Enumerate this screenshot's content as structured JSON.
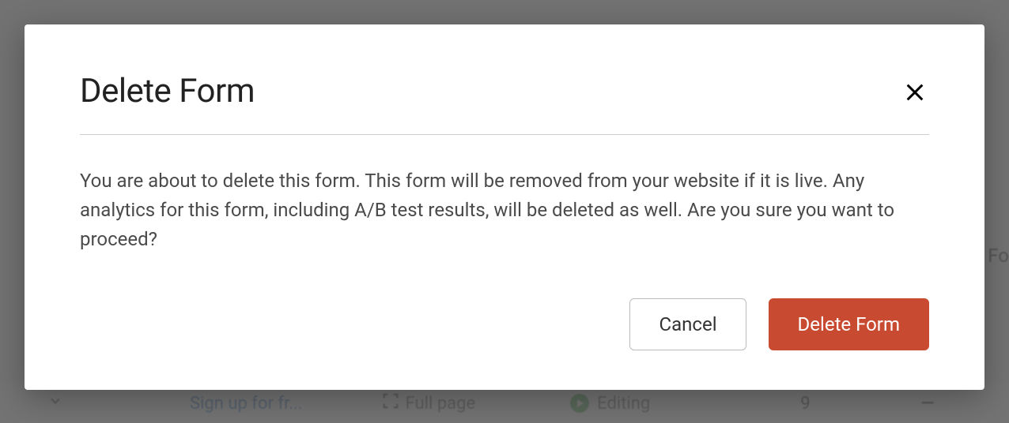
{
  "modal": {
    "title": "Delete Form",
    "body": "You are about to delete this form. This form will be removed from your website if it is live. Any analytics for this form, including A/B test results, will be deleted as well. Are you sure you want to proceed?",
    "cancel_label": "Cancel",
    "confirm_label": "Delete Form"
  },
  "background": {
    "row": {
      "link_text": "Sign up for fr...",
      "display_type": "Full page",
      "status": "Editing",
      "count": "9",
      "dash": "—"
    },
    "right_partial": "Fo"
  },
  "colors": {
    "danger": "#c84b31",
    "text": "#4a4a4a"
  }
}
